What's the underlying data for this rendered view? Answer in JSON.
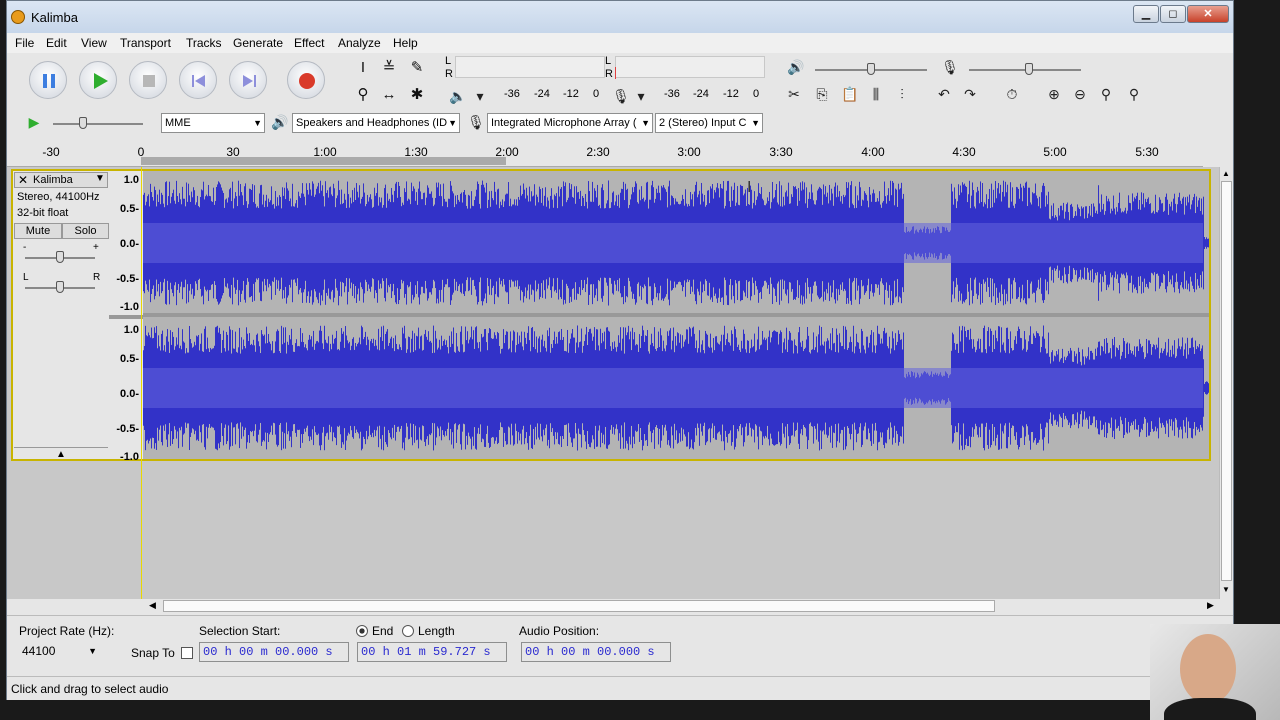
{
  "window": {
    "title": "Kalimba"
  },
  "menu": [
    "File",
    "Edit",
    "View",
    "Transport",
    "Tracks",
    "Generate",
    "Effect",
    "Analyze",
    "Help"
  ],
  "meters": {
    "playback_channels": [
      "L",
      "R"
    ],
    "record_channels": [
      "L",
      "R"
    ],
    "scale": [
      "-36",
      "-24",
      "-12",
      "0"
    ]
  },
  "device": {
    "host": "MME",
    "output": "Speakers and Headphones (ID",
    "input": "Integrated Microphone Array (",
    "channels": "2 (Stereo) Input C"
  },
  "ruler": {
    "labels": [
      "-30",
      "0",
      "30",
      "1:00",
      "1:30",
      "2:00",
      "2:30",
      "3:00",
      "3:30",
      "4:00",
      "4:30",
      "5:00",
      "5:30"
    ]
  },
  "track": {
    "name": "Kalimba",
    "format": "Stereo, 44100Hz",
    "bit_depth": "32-bit float",
    "mute_label": "Mute",
    "solo_label": "Solo",
    "gain_minus": "-",
    "gain_plus": "+",
    "pan_left": "L",
    "pan_right": "R",
    "scale": [
      "1.0",
      "0.5-",
      "0.0-",
      "-0.5-",
      "-1.0"
    ],
    "waveform_color": "#3232c8",
    "selection_color": "#b4b4b4"
  },
  "selection": {
    "project_rate_label": "Project Rate (Hz):",
    "project_rate": "44100",
    "snap_label": "Snap To",
    "start_label": "Selection Start:",
    "end_label": "End",
    "length_label": "Length",
    "position_label": "Audio Position:",
    "start_value": "00 h 00 m 00.000 s",
    "end_value": "00 h 01 m 59.727 s",
    "position_value": "00 h 00 m 00.000 s"
  },
  "status": {
    "text": "Click and drag to select audio"
  }
}
